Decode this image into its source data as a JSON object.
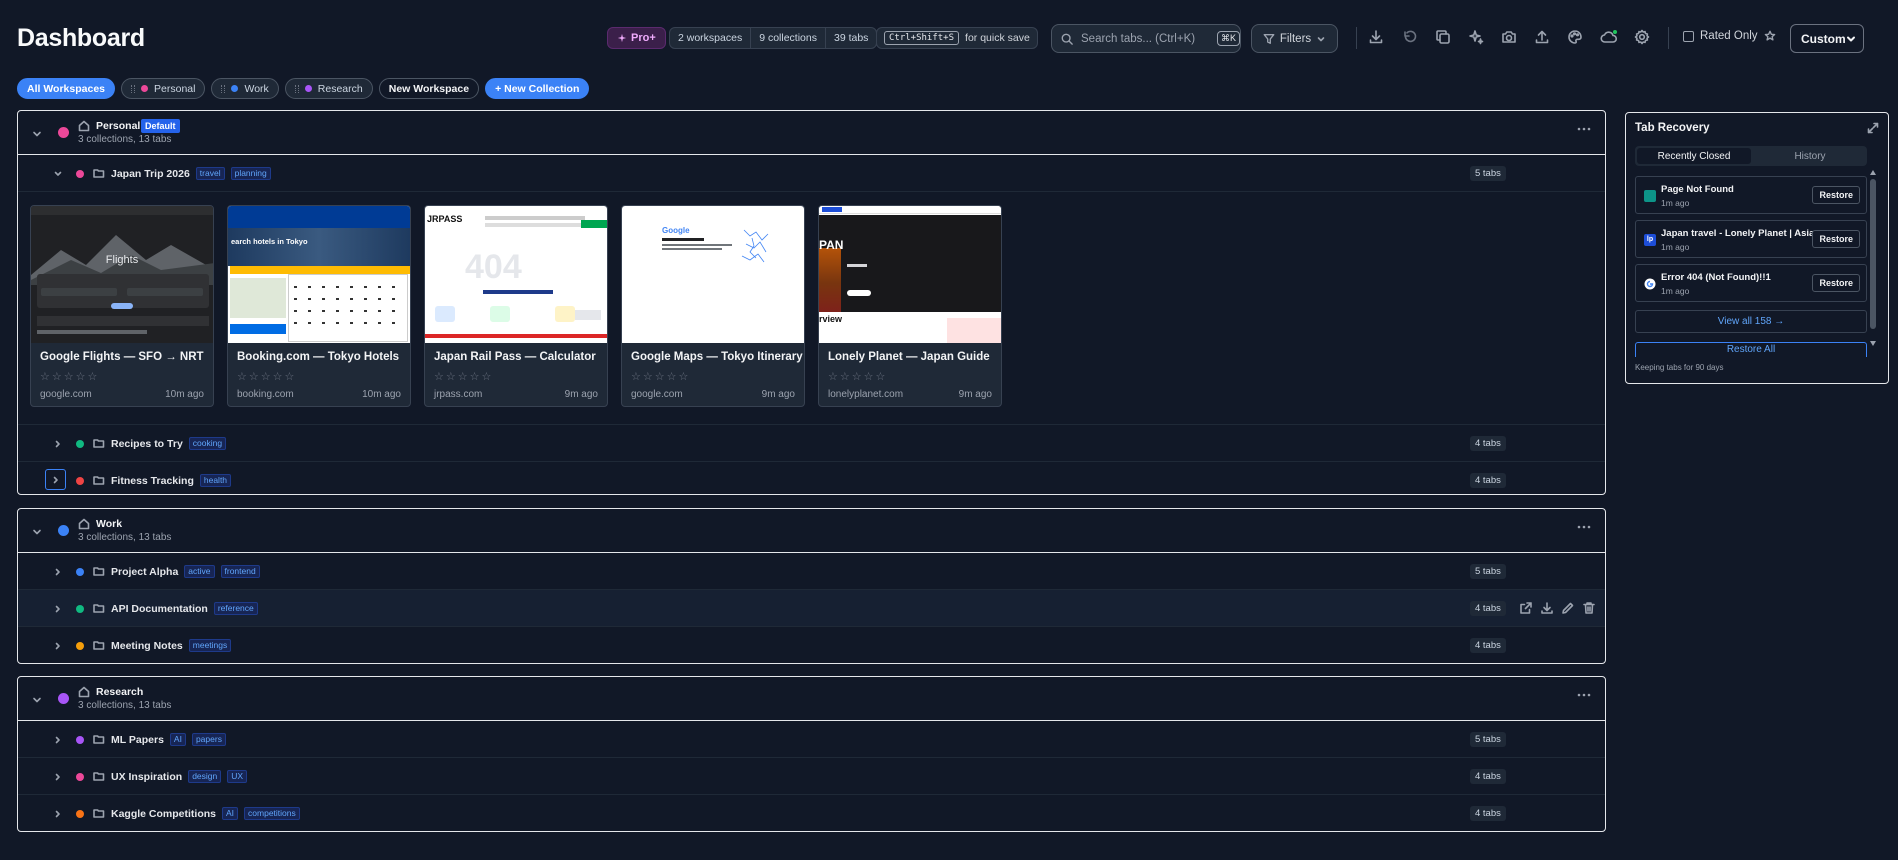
{
  "header": {
    "title": "Dashboard",
    "pro_label": "Pro+",
    "stats": {
      "workspaces": "2 workspaces",
      "collections": "9 collections",
      "tabs": "39 tabs"
    },
    "quick_save": {
      "shortcut": "Ctrl+Shift+S",
      "text": "for quick save"
    },
    "search": {
      "placeholder": "Search tabs... (Ctrl+K)",
      "shortcut": "⌘K"
    },
    "filters_label": "Filters",
    "toolbar_icons": [
      "download-icon",
      "undo-icon",
      "copy-icon",
      "sparkles-icon",
      "camera-icon",
      "upload-icon",
      "palette-icon",
      "cloud-icon",
      "settings-icon"
    ],
    "rated_only_label": "Rated Only",
    "view_select": "Custom"
  },
  "pills": {
    "all": "All Workspaces",
    "personal": "Personal",
    "work": "Work",
    "research": "Research",
    "new_workspace": "New Workspace",
    "new_collection": "+ New Collection"
  },
  "colors": {
    "accent": "#3b82f6",
    "personal": "#ec4899",
    "work": "#3b82f6",
    "research": "#a855f7",
    "green": "#10b981",
    "red": "#ef4444",
    "orange": "#f59e0b"
  },
  "workspaces": [
    {
      "name": "Personal",
      "badge": "Default",
      "summary": "3 collections, 13 tabs",
      "collections": [
        {
          "name": "Japan Trip 2026",
          "tags": [
            "travel",
            "planning"
          ],
          "count": "5 tabs",
          "expanded": true
        },
        {
          "name": "Recipes to Try",
          "tags": [
            "cooking"
          ],
          "count": "4 tabs"
        },
        {
          "name": "Fitness Tracking",
          "tags": [
            "health"
          ],
          "count": "4 tabs"
        }
      ]
    },
    {
      "name": "Work",
      "summary": "3 collections, 13 tabs",
      "collections": [
        {
          "name": "Project Alpha",
          "tags": [
            "active",
            "frontend"
          ],
          "count": "5 tabs"
        },
        {
          "name": "API Documentation",
          "tags": [
            "reference"
          ],
          "count": "4 tabs"
        },
        {
          "name": "Meeting Notes",
          "tags": [
            "meetings"
          ],
          "count": "4 tabs"
        }
      ]
    },
    {
      "name": "Research",
      "summary": "3 collections, 13 tabs",
      "collections": [
        {
          "name": "ML Papers",
          "tags": [
            "AI",
            "papers"
          ],
          "count": "5 tabs"
        },
        {
          "name": "UX Inspiration",
          "tags": [
            "design",
            "UX"
          ],
          "count": "4 tabs"
        },
        {
          "name": "Kaggle Competitions",
          "tags": [
            "AI",
            "competitions"
          ],
          "count": "4 tabs"
        }
      ]
    }
  ],
  "cards": [
    {
      "title": "Google Flights — SFO → NRT",
      "domain": "google.com",
      "ago": "10m ago",
      "thumb_text": "Flights"
    },
    {
      "title": "Booking.com — Tokyo Hotels",
      "domain": "booking.com",
      "ago": "10m ago",
      "thumb_text": "earch hotels in Tokyo"
    },
    {
      "title": "Japan Rail Pass — Calculator",
      "domain": "jrpass.com",
      "ago": "9m ago",
      "thumb_text": "JRPASS"
    },
    {
      "title": "Google Maps — Tokyo Itinerary",
      "domain": "google.com",
      "ago": "9m ago",
      "thumb_text": "Google"
    },
    {
      "title": "Lonely Planet — Japan Guide",
      "domain": "lonelyplanet.com",
      "ago": "9m ago",
      "thumb_text": "PAN",
      "thumb_text2": "rview"
    }
  ],
  "recovery": {
    "title": "Tab Recovery",
    "tabs": [
      "Recently Closed",
      "History"
    ],
    "items": [
      {
        "name": "Page Not Found",
        "time": "1m ago",
        "icon": "teal-page-icon"
      },
      {
        "name": "Japan travel - Lonely Planet | Asia",
        "time": "1m ago",
        "icon": "lonely-planet-icon"
      },
      {
        "name": "Error 404 (Not Found)!!1",
        "time": "1m ago",
        "icon": "google-icon"
      }
    ],
    "restore_label": "Restore",
    "view_all": "View all 158 →",
    "restore_all": "Restore All",
    "keeping": "Keeping tabs for 90 days"
  }
}
